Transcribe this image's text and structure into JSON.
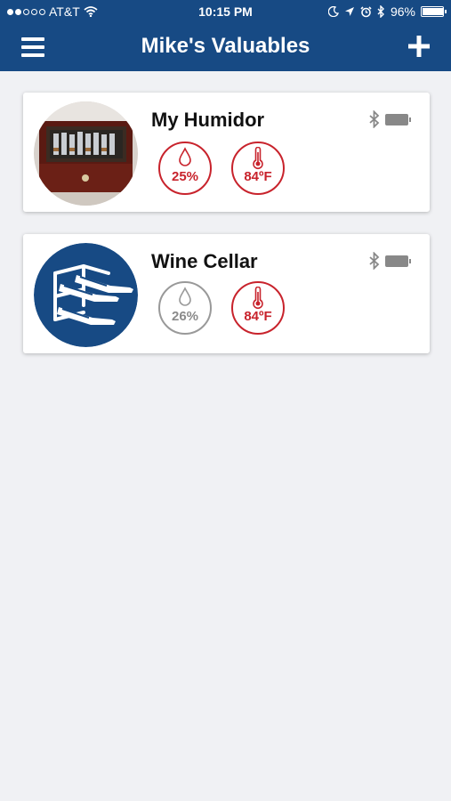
{
  "status_bar": {
    "carrier": "AT&T",
    "time": "10:15 PM",
    "battery": "96%"
  },
  "header": {
    "title": "Mike's Valuables"
  },
  "colors": {
    "header": "#174a84",
    "alert_red": "#c8232c",
    "normal_gray": "#8a8a8a",
    "background": "#f0f1f4"
  },
  "devices": [
    {
      "name": "My Humidor",
      "humidity": "25%",
      "temperature": "84ºF",
      "humidity_icon": "droplet-icon",
      "temperature_icon": "thermometer-icon"
    },
    {
      "name": "Wine Cellar",
      "humidity": "26%",
      "temperature": "84ºF",
      "humidity_icon": "droplet-icon",
      "temperature_icon": "thermometer-icon"
    }
  ]
}
